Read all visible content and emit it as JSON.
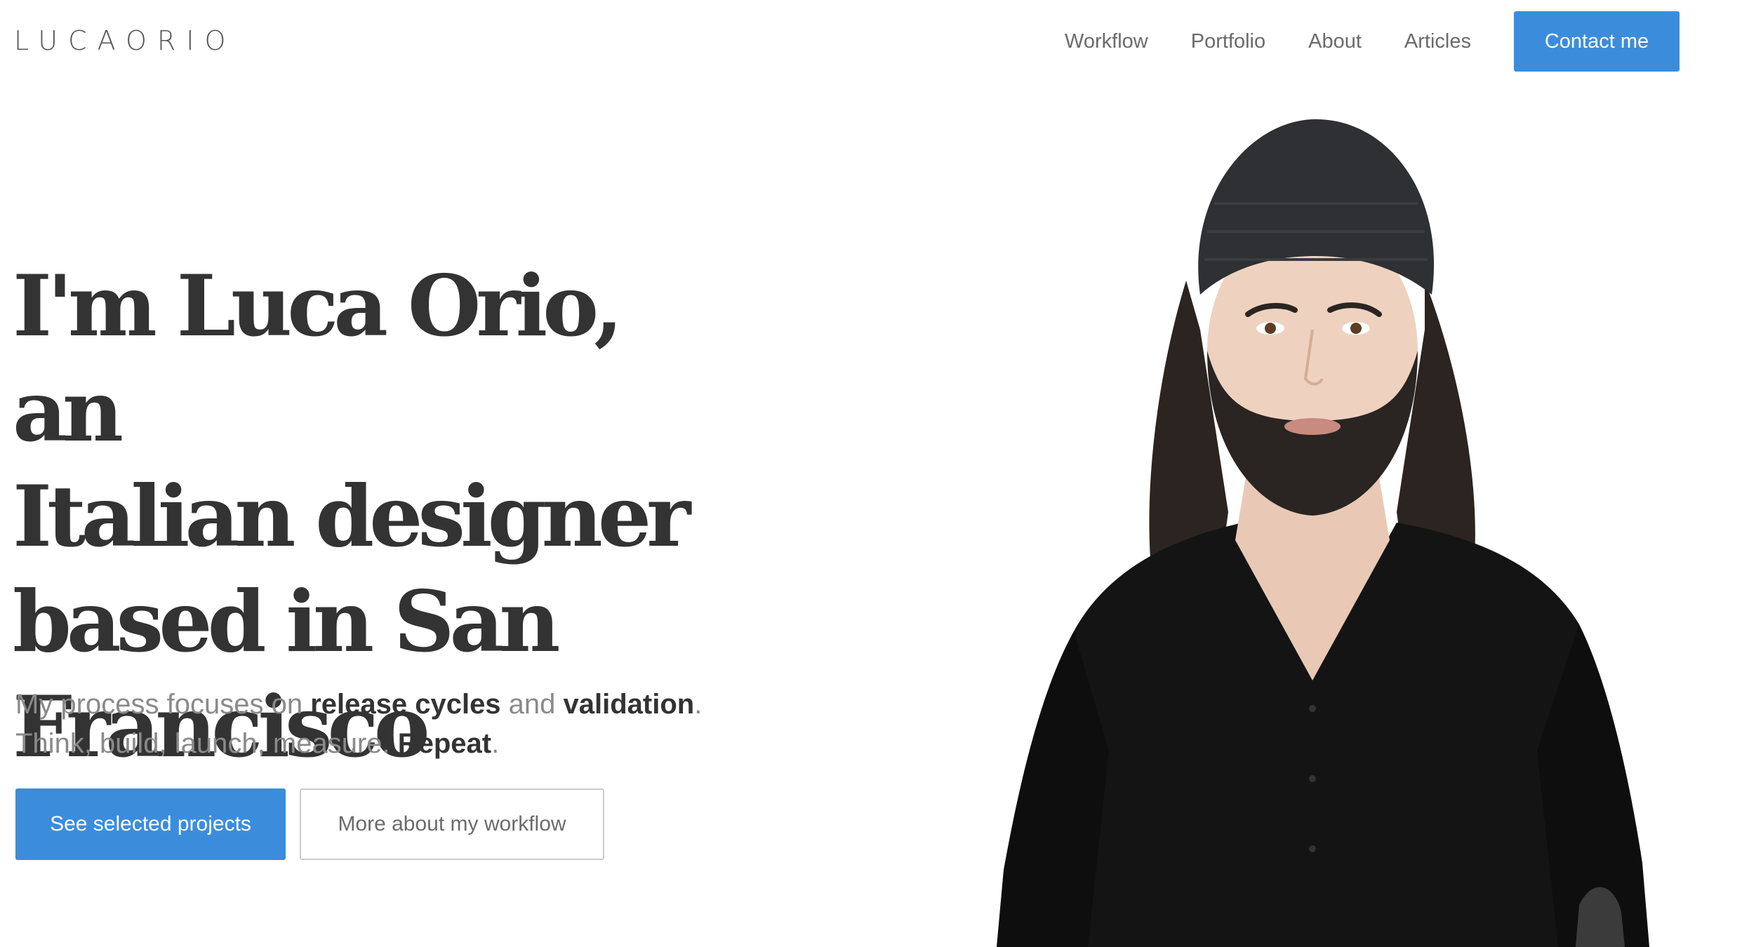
{
  "header": {
    "logo_text": "LUCAORIO",
    "nav": {
      "workflow": "Workflow",
      "portfolio": "Portfolio",
      "about": "About",
      "articles": "Articles"
    },
    "contact_label": "Contact me"
  },
  "hero": {
    "title_lines": [
      "I'm Luca Orio, an",
      "Italian designer",
      "based in San",
      "Francisco"
    ],
    "subtitle": {
      "p1": "My process focuses on ",
      "b1": "release cycles",
      "p2": " and ",
      "b2": "validation",
      "p3": ".",
      "p4": "Think, build, launch, measure. ",
      "b3": "Repeat",
      "p5": "."
    },
    "primary_button": "See selected projects",
    "secondary_button": "More about my workflow"
  },
  "colors": {
    "accent": "#3b8ddc",
    "text_dark": "#333333",
    "text_muted": "#8a8a8a",
    "nav_text": "#6b6b6b"
  }
}
